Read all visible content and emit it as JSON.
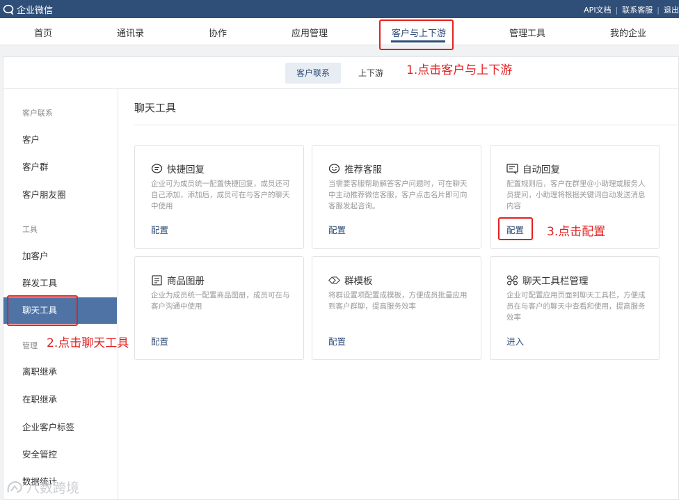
{
  "topbar": {
    "app_name": "企业微信",
    "links": [
      "API文档",
      "联系客服",
      "退出"
    ]
  },
  "nav": {
    "items": [
      "首页",
      "通讯录",
      "协作",
      "应用管理",
      "客户与上下游",
      "管理工具",
      "我的企业"
    ],
    "active": "客户与上下游"
  },
  "subtabs": {
    "active": "客户联系",
    "other": "上下游"
  },
  "sidebar": {
    "group_customer": "客户联系",
    "customer": "客户",
    "customer_group": "客户群",
    "moments": "客户朋友圈",
    "group_tools": "工具",
    "add_customer": "加客户",
    "mass_send": "群发工具",
    "chat_tools": "聊天工具",
    "group_manage": "管理",
    "resign_inherit": "离职继承",
    "onjob_inherit": "在职继承",
    "customer_tags": "企业客户标签",
    "security": "安全管控",
    "statistics": "数据统计"
  },
  "panel": {
    "title": "聊天工具",
    "cards": [
      {
        "title": "快捷回复",
        "desc": "企业可为成员统一配置快捷回复，成员还可自己添加，添加后，成员可在与客户的聊天中使用",
        "link": "配置",
        "icon": "chat-bubble-icon"
      },
      {
        "title": "推荐客服",
        "desc": "当需要客服帮助解答客户问题时，可在聊天中主动推荐微信客服，客户点击名片即可向客服发起咨询。",
        "link": "配置",
        "icon": "smile-chat-icon"
      },
      {
        "title": "自动回复",
        "desc": "配置规则后，客户在群里@小助理或服务人员提问，小助理将根据关键词自动发送消息内容",
        "link": "配置",
        "icon": "auto-reply-icon"
      },
      {
        "title": "商品图册",
        "desc": "企业为成员统一配置商品图册，成员可在与客户沟通中使用",
        "link": "配置",
        "icon": "album-icon"
      },
      {
        "title": "群模板",
        "desc": "将群设置项配置成模板，方便成员批量应用到客户群聊，提高服务效率",
        "link": "配置",
        "icon": "diamond-template-icon"
      },
      {
        "title": "聊天工具栏管理",
        "desc": "企业可配置应用页面到聊天工具栏，方便成员在与客户的聊天中查看和使用，提高服务效率",
        "link": "进入",
        "icon": "toolbar-grid-icon"
      }
    ]
  },
  "annotations": {
    "step1": "1.点击客户与上下游",
    "step2": "2.点击聊天工具",
    "step3": "3.点击配置",
    "color": "#e32020"
  },
  "watermark": "八数跨境",
  "colors": {
    "brand": "#2f4e78",
    "sidebar_active": "#4f73a5"
  }
}
